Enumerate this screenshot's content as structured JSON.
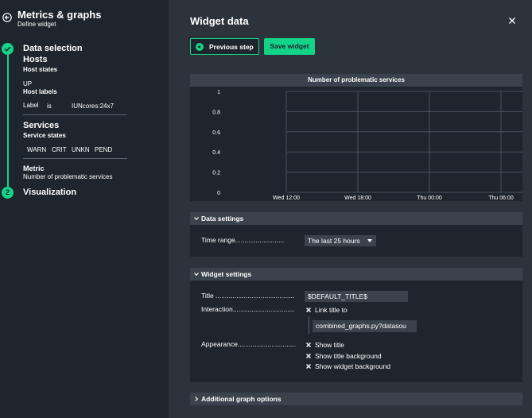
{
  "sidebar": {
    "title": "Metrics & graphs",
    "subtitle": "Define widget",
    "step1": {
      "title": "Data selection",
      "hosts_heading": "Hosts",
      "host_states_label": "Host states",
      "host_states_value": "UP",
      "host_labels_label": "Host labels",
      "label_key": "Label",
      "label_op": "is",
      "label_value": "IUNcores:24x7",
      "services_heading": "Services",
      "service_states_label": "Service states",
      "service_states": [
        "WARN",
        "CRIT",
        "UNKN",
        "PEND"
      ],
      "metric_label": "Metric",
      "metric_value": "Number of problematic services"
    },
    "step2": {
      "number": "2",
      "title": "Visualization"
    }
  },
  "main": {
    "title": "Widget data",
    "prev_button": "Previous step",
    "save_button": "Save widget"
  },
  "chart_data": {
    "type": "line",
    "title": "Number of problematic services",
    "x_ticks": [
      "Wed 12:00",
      "Wed 18:00",
      "Thu 00:00",
      "Thu 06:00"
    ],
    "y_ticks": [
      "0",
      "0.2",
      "0.4",
      "0.6",
      "0.8",
      "1"
    ],
    "ylim": [
      0,
      1
    ],
    "grid": true,
    "series": []
  },
  "data_settings": {
    "heading": "Data settings",
    "time_range_label": "Time range..........................",
    "time_range_value": "The last 25 hours"
  },
  "widget_settings": {
    "heading": "Widget settings",
    "title_label": "Title ..........................................",
    "title_value": "$DEFAULT_TITLE$",
    "interaction_label": "Interaction.................................",
    "link_title_label": "Link title to",
    "link_value": "combined_graphs.py?datasou",
    "appearance_label": "Appearance...............................",
    "show_title": "Show title",
    "show_title_bg": "Show title background",
    "show_widget_bg": "Show widget background"
  },
  "additional": {
    "heading": "Additional graph options"
  },
  "colors": {
    "accent": "#13d389",
    "panel_dark": "#1e252c",
    "panel": "#2c333b",
    "bar": "#3a424b"
  }
}
